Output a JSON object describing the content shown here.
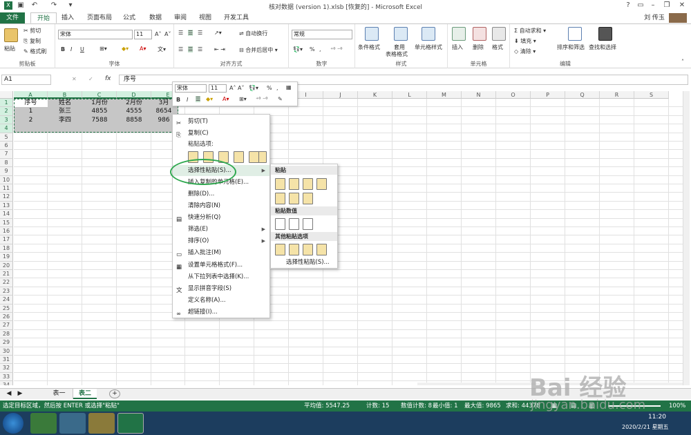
{
  "window": {
    "title": "核对数据 (version 1).xlsb [恢复的] - Microsoft Excel",
    "user": "刘 传玉",
    "help": "?",
    "min": "–",
    "restore": "❐",
    "close": "✕"
  },
  "tabs": [
    "文件",
    "开始",
    "插入",
    "页面布局",
    "公式",
    "数据",
    "审阅",
    "视图",
    "开发工具"
  ],
  "ribbon": {
    "clipboard": {
      "paste": "粘贴",
      "cut": "剪切",
      "copy": "复制",
      "painter": "格式刷",
      "label": "剪贴板"
    },
    "font": {
      "name": "宋体",
      "size": "11",
      "label": "字体",
      "bold": "B",
      "italic": "I",
      "underline": "U",
      "grow": "A˄",
      "shrink": "A˅"
    },
    "align": {
      "wrap": "自动换行",
      "merge": "合并后居中",
      "label": "对齐方式"
    },
    "number": {
      "format": "常规",
      "percent": "%",
      "comma": ",",
      "label": "数字"
    },
    "styles": {
      "cond": "条件格式",
      "table1": "套用",
      "table2": "表格格式",
      "cell": "单元格样式",
      "label": "样式"
    },
    "cells": {
      "insert": "插入",
      "delete": "删除",
      "format": "格式",
      "label": "单元格"
    },
    "edit": {
      "autosum": "自动求和",
      "fill": "填充",
      "clear": "清除",
      "sort": "排序和筛选",
      "find": "查找和选择",
      "label": "编辑"
    }
  },
  "formula": {
    "namebox": "A1",
    "value": "序号",
    "cancel": "✕",
    "enter": "✓",
    "fx": "fx"
  },
  "columns": [
    "A",
    "B",
    "C",
    "D",
    "E",
    "F",
    "G",
    "H",
    "I",
    "J",
    "K",
    "L",
    "M",
    "N",
    "O",
    "P",
    "Q",
    "R",
    "S"
  ],
  "rows": [
    "1",
    "2",
    "3",
    "4",
    "5",
    "6",
    "7",
    "8",
    "9",
    "10",
    "11",
    "12",
    "13",
    "14",
    "15",
    "16",
    "17",
    "18",
    "19",
    "20",
    "21",
    "22",
    "23",
    "24",
    "25",
    "26",
    "27",
    "28",
    "29",
    "30",
    "31",
    "32",
    "33",
    "34"
  ],
  "cells": [
    [
      "序号",
      "姓名",
      "1月份",
      "2月份",
      "3月"
    ],
    [
      "1",
      "张三",
      "4855",
      "4555",
      "8654"
    ],
    [
      "2",
      "李四",
      "7588",
      "8858",
      "986"
    ]
  ],
  "context_menu": {
    "cut": "剪切(T)",
    "copy": "复制(C)",
    "paste_options": "粘贴选项:",
    "paste_special": "选择性粘贴(S)...",
    "insert_copied": "插入复制的单元格(E)...",
    "delete": "删除(D)...",
    "clear": "清除内容(N)",
    "quick": "快速分析(Q)",
    "filter": "筛选(E)",
    "sort": "排序(O)",
    "comment": "插入批注(M)",
    "format_cells": "设置单元格格式(F)...",
    "pick_list": "从下拉列表中选择(K)...",
    "phonetic": "显示拼音字段(S)",
    "define_name": "定义名称(A)...",
    "hyperlink": "超链接(I)..."
  },
  "submenu": {
    "paste": "粘贴",
    "paste_values": "粘贴数值",
    "other": "其他粘贴选项",
    "special": "选择性粘贴(S)..."
  },
  "mini_toolbar": {
    "font": "宋体",
    "size": "11",
    "percent": "%",
    "comma": ","
  },
  "sheets": {
    "tab1": "表一",
    "tab2": "表二",
    "add": "+"
  },
  "status": {
    "message": "选定目标区域，然后按 ENTER 或选择\"粘贴\"",
    "average": "平均值: 5547.25",
    "count": "计数: 15",
    "numcount": "数值计数: 8",
    "min": "最小值: 1",
    "max": "最大值: 9865",
    "sum": "求和: 44378",
    "zoom": "100%"
  },
  "taskbar": {
    "time": "11:20",
    "date": "2020/2/21 星期五"
  },
  "watermark": {
    "main": "Bai 经验",
    "url": "jingyan.baidu.com"
  },
  "colors": {
    "excel_green": "#217346",
    "select_fill": "#c6c6c6",
    "oval": "#2fa84f"
  }
}
